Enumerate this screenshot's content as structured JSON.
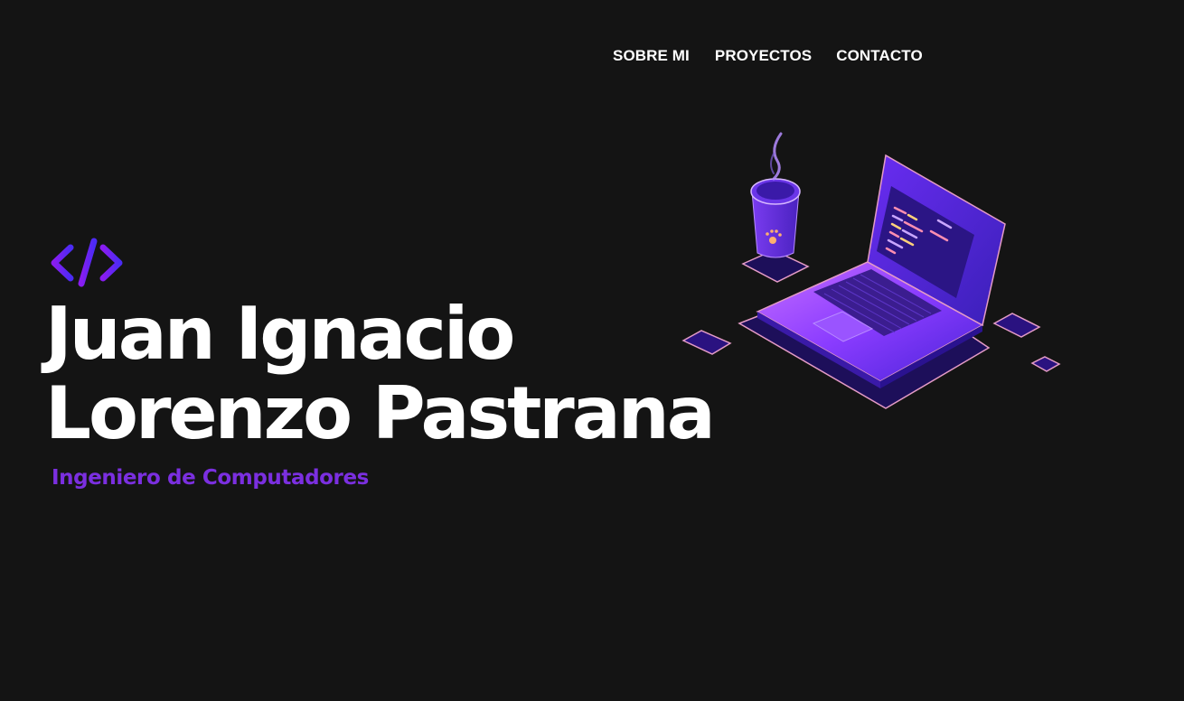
{
  "nav": {
    "items": [
      {
        "label": "SOBRE MI"
      },
      {
        "label": "PROYECTOS"
      },
      {
        "label": "CONTACTO"
      }
    ]
  },
  "hero": {
    "icon": "code-brackets-icon",
    "name_line1": "Juan Ignacio",
    "name_line2": "Lorenzo Pastrana",
    "subtitle": "Ingeniero de Computadores",
    "illustration": "laptop-coffee-illustration"
  },
  "colors": {
    "background": "#141414",
    "text": "#ffffff",
    "accent": "#7b2fe0",
    "accent_light": "#a64bff",
    "accent_pink": "#e49bc6"
  }
}
